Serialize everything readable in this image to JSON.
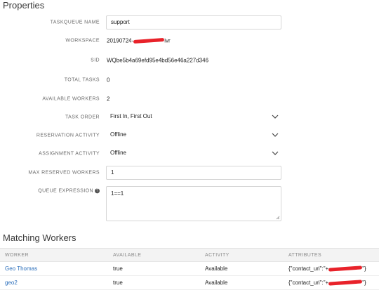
{
  "properties": {
    "title": "Properties",
    "taskqueue_name": {
      "label": "TASKQUEUE NAME",
      "value": "support"
    },
    "workspace": {
      "label": "WORKSPACE",
      "value_prefix": "20190724-",
      "value_suffix": "ivr"
    },
    "sid": {
      "label": "SID",
      "value": "WQbe5b4a69efd95e4bd56e46a227d346"
    },
    "total_tasks": {
      "label": "TOTAL TASKS",
      "value": "0"
    },
    "available_workers": {
      "label": "AVAILABLE WORKERS",
      "value": "2"
    },
    "task_order": {
      "label": "TASK ORDER",
      "value": "First In, First Out"
    },
    "reservation_activity": {
      "label": "RESERVATION ACTIVITY",
      "value": "Offline"
    },
    "assignment_activity": {
      "label": "ASSIGNMENT ACTIVITY",
      "value": "Offline"
    },
    "max_reserved_workers": {
      "label": "MAX RESERVED WORKERS",
      "value": "1"
    },
    "queue_expression": {
      "label": "QUEUE EXPRESSION",
      "value": "1==1"
    }
  },
  "matching": {
    "title": "Matching Workers",
    "headers": [
      "WORKER",
      "AVAILABLE",
      "ACTIVITY",
      "ATTRIBUTES"
    ],
    "rows": [
      {
        "worker": "Geo Thomas",
        "available": "true",
        "activity": "Available",
        "attr_prefix": "{\"contact_uri\":\"+",
        "attr_suffix": "\"}"
      },
      {
        "worker": "geo2",
        "available": "true",
        "activity": "Available",
        "attr_prefix": "{\"contact_uri\":\"+",
        "attr_suffix": "\"}"
      }
    ]
  },
  "colors": {
    "link": "#2a6ebb",
    "redaction": "#e8222a",
    "label": "#6b6b6b",
    "header_bg": "#f3f3f3"
  },
  "icons": [
    "chevron-down-icon",
    "help-icon",
    "resize-grip-icon"
  ]
}
